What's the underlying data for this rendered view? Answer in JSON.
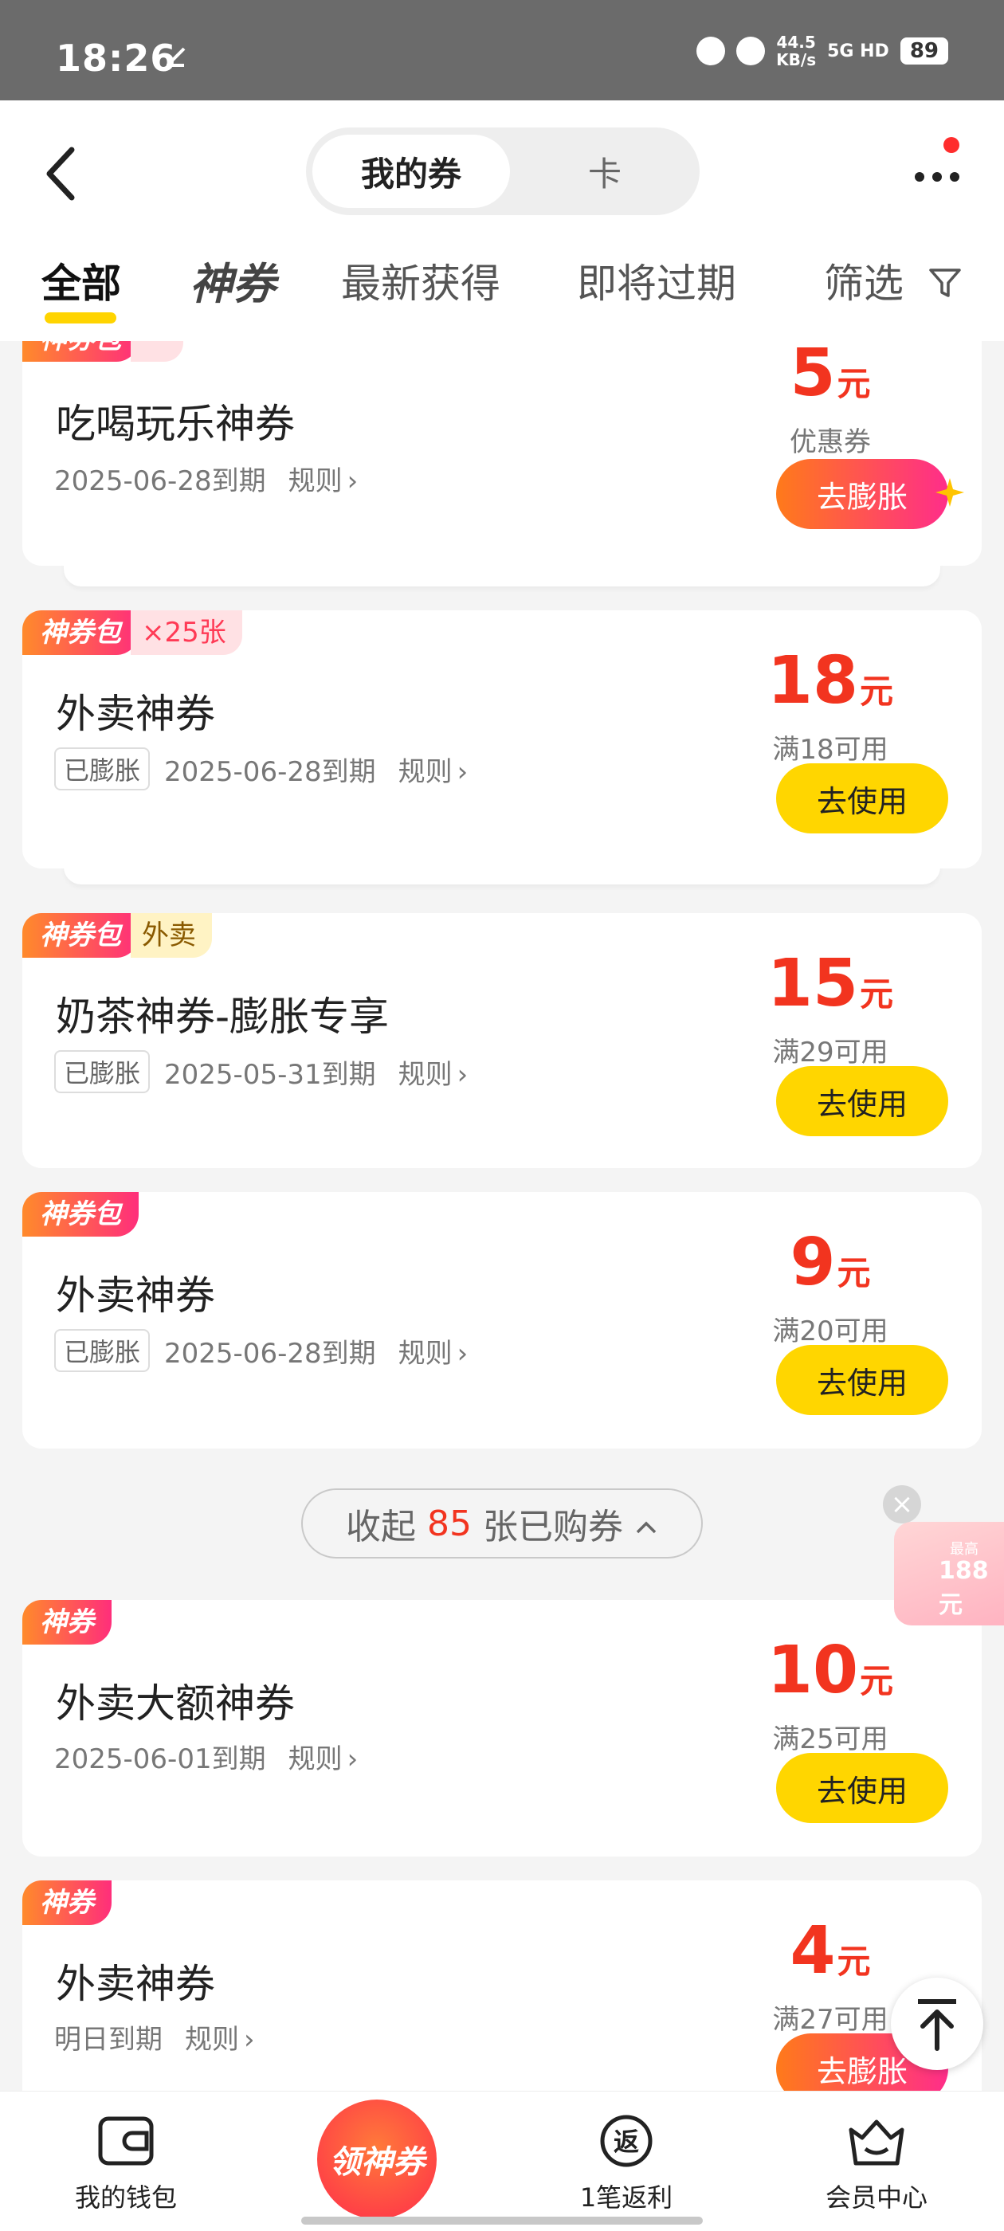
{
  "status": {
    "time": "18:26",
    "download_icon": "download-done-icon",
    "speed_value": "44.5",
    "speed_unit": "KB/s",
    "network": "5G HD",
    "battery": "89"
  },
  "header": {
    "segment_active": "我的券",
    "segment_inactive": "卡"
  },
  "tabs": {
    "all": "全部",
    "shenquan": "神券",
    "newest": "最新获得",
    "expiring": "即将过期",
    "filter": "筛选"
  },
  "cards": [
    {
      "tag": "神券包",
      "tag2": "",
      "title": "吃喝玩乐神券",
      "chip": "",
      "expiry": "2025-06-28到期",
      "rule": "规则",
      "amount": "5",
      "unit": "元",
      "cond": "优惠券",
      "button": "去膨胀"
    },
    {
      "tag": "神券包",
      "tag2": "×25张",
      "title": "外卖神券",
      "chip": "已膨胀",
      "expiry": "2025-06-28到期",
      "rule": "规则",
      "amount": "18",
      "unit": "元",
      "cond": "满18可用",
      "button": "去使用"
    },
    {
      "tag": "神券包",
      "tag2": "外卖",
      "title": "奶茶神券-膨胀专享",
      "chip": "已膨胀",
      "expiry": "2025-05-31到期",
      "rule": "规则",
      "amount": "15",
      "unit": "元",
      "cond": "满29可用",
      "button": "去使用"
    },
    {
      "tag": "神券包",
      "tag2": "",
      "title": "外卖神券",
      "chip": "已膨胀",
      "expiry": "2025-06-28到期",
      "rule": "规则",
      "amount": "9",
      "unit": "元",
      "cond": "满20可用",
      "button": "去使用"
    },
    {
      "tag": "神券",
      "tag2": "",
      "title": "外卖大额神券",
      "chip": "",
      "expiry": "2025-06-01到期",
      "rule": "规则",
      "amount": "10",
      "unit": "元",
      "cond": "满25可用",
      "button": "去使用"
    },
    {
      "tag": "神券",
      "tag2": "",
      "title": "外卖神券",
      "chip": "",
      "expiry": "明日到期",
      "rule": "规则",
      "amount": "4",
      "unit": "元",
      "cond": "满27可用",
      "button": "去膨胀"
    }
  ],
  "collapse": {
    "prefix": "收起",
    "count": "85",
    "suffix": "张已购券"
  },
  "float_badge": {
    "line1": "最高",
    "line2": "188元"
  },
  "bottom_nav": {
    "wallet": "我的钱包",
    "center": "领神券",
    "rebate": "1笔返利",
    "member": "会员中心"
  }
}
